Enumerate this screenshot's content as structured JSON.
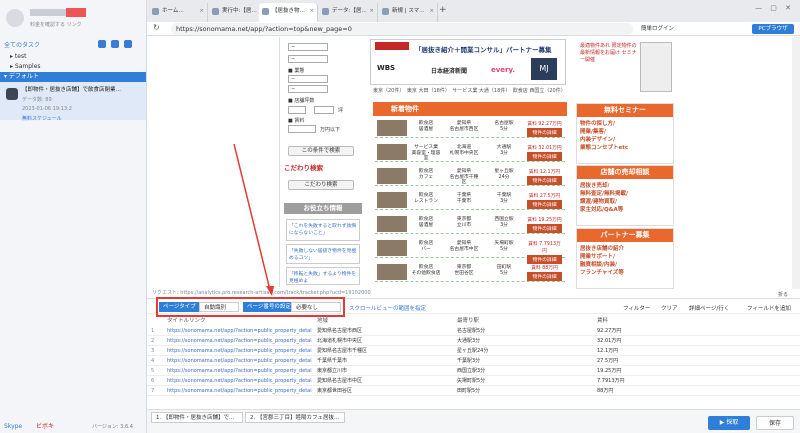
{
  "sidebar": {
    "account_sub": "料金を確認する リンク",
    "header": "全てのタスク",
    "tree": [
      {
        "label": "test"
      },
      {
        "label": "Samples"
      },
      {
        "label": "デフォルト"
      }
    ],
    "task": {
      "title": "【即物件・居抜き店舗】で飲食店閉業…",
      "created_label": "データ数: 89",
      "date": "2023-01-06 19:13:2",
      "status": "無料スケジュール"
    },
    "footer": {
      "skype": "Skype",
      "weibo": "ビボキ",
      "version": "バージョン: 3.6.4"
    }
  },
  "tabs": [
    {
      "label": "ホーム…",
      "active": false
    },
    {
      "label": "実行中:【居…",
      "active": false
    },
    {
      "label": "【居抜き物…",
      "active": true
    },
    {
      "label": "データ:【居…",
      "active": false
    },
    {
      "label": "新規 | スマ…",
      "active": false
    }
  ],
  "urlbar": {
    "url": "https://sonomama.net/app/?action=top&new_page=0",
    "login": "簡単ログイン",
    "browser_btn": "PCブラウザ"
  },
  "web": {
    "filters": {
      "label_kind": "業態",
      "label_area": "店舗坪数",
      "tsubo_unit": "坪",
      "label_rent": "賃料",
      "rent_unit": "万円以下",
      "select_default": "−",
      "search_btn": "この条件で検索",
      "kodawari_title": "こだわり検索",
      "kodawari_btn": "こだわり検索",
      "info_title": "お役立ち情報",
      "info_links": [
        "「これを失敗すると取れず後悔にならないこと」",
        "「失敗しない居抜き物件を見極めるコツ」",
        "「移転と失敗」するより物件を見極めよ"
      ]
    },
    "banner_top": "「居抜き紹介＋開業コンサル」パートナー募集",
    "logos": [
      "WBS",
      "日本経済新聞",
      "every.",
      "MJ"
    ],
    "stats": "東京（20件）　東京 大田（18件）　サービス業 大通（18件）　飲食店 西国立（20件）",
    "new_title": "新着物件",
    "listings": [
      {
        "type": "飲食店\n居酒屋",
        "area": "愛知県\n名古屋市西区",
        "station": "名古屋駅\n5分",
        "rent": "賃料 92.27万円",
        "go": "物件の詳細"
      },
      {
        "type": "サービス業\n美容室・理容室",
        "area": "北海道\n札幌市中央区",
        "station": "大通駅\n3分",
        "rent": "賃料 32.01万円",
        "go": "物件の詳細"
      },
      {
        "type": "飲食店\nカフェ",
        "area": "愛知県\n名古屋市千種区",
        "station": "星ヶ丘駅\n24分",
        "rent": "賃料 12.1万円",
        "go": "物件の詳細"
      },
      {
        "type": "飲食店\nレストラン",
        "area": "千葉県\n千葉市",
        "station": "千葉駅\n3分",
        "rent": "賃料 27.5万円",
        "go": "物件の詳細"
      },
      {
        "type": "飲食店\n居酒屋",
        "area": "東京都\n立川市",
        "station": "西国立駅\n3分",
        "rent": "賃料 19.25万円",
        "go": "物件の詳細"
      },
      {
        "type": "飲食店\nバー",
        "area": "愛知県\n名古屋市中区",
        "station": "矢場町駅\n5分",
        "rent": "賃料 7.7913万円",
        "go": "物件の詳細"
      },
      {
        "type": "飲食店\nその他飲食店",
        "area": "東京都\n世田谷区",
        "station": "田町駅\n5分",
        "rent": "賃料 88万円",
        "go": "物件の詳細"
      }
    ],
    "side_cards": [
      {
        "title": "無料セミナー",
        "body": "物件の探し方/\n開業/集客/\n内装デザイン/\n業態コンセプトetc"
      },
      {
        "title": "店舗の売却相談",
        "body": "居抜き売却/\n無料査定/無料掲載/\n譲渡/建物買取/\n家主対応/Q&A等"
      },
      {
        "title": "パートナー募集",
        "body": "居抜き店舗の紹介\n開業サポート/\n融資相談/内装/\nフランチャイズ等"
      }
    ],
    "promo_top_right": "最適物件あれ 限定物件の\n最新情報をお届け セミナー開催"
  },
  "capture": {
    "chip1": "ページタイプ",
    "chip1_val": "自動識別",
    "chip2": "ページ番号の設定",
    "chip2_val": "必要なし",
    "scroll_link": "スクロールビューの範囲を指定",
    "filter": "フィルター",
    "clear": "クリア",
    "detail": "詳細ページ/行く",
    "add_field": "フィールドを追加",
    "fold": "折る"
  },
  "status_url": "リクエスト: https://analytics.pro.research-artisan.com/track/tracker.php?ucd=19102000",
  "table": {
    "headers": [
      "タイトルリンク",
      "地域",
      "最寄り駅",
      "賃料"
    ],
    "rows": [
      {
        "n": "1",
        "link": "https://sonomama.net/app/?action=public_property_detail&pid=57",
        "area": "愛知県名古屋市西区",
        "st": "名古屋駅5分",
        "rent": "92.27万円"
      },
      {
        "n": "2",
        "link": "https://sonomama.net/app/?action=public_property_detail&pid=57",
        "area": "北海道札幌市中央区",
        "st": "大通駅3分",
        "rent": "32.01万円"
      },
      {
        "n": "3",
        "link": "https://sonomama.net/app/?action=public_property_detail&pid=57",
        "area": "愛知県名古屋市千種区",
        "st": "星ヶ丘駅24分",
        "rent": "12.1万円"
      },
      {
        "n": "4",
        "link": "https://sonomama.net/app/?action=public_property_detail&pid=57",
        "area": "千葉県千葉市",
        "st": "千葉駅3分",
        "rent": "27.5万円"
      },
      {
        "n": "5",
        "link": "https://sonomama.net/app/?action=public_property_detail&pid=57",
        "area": "東京都立川市",
        "st": "西国立駅3分",
        "rent": "19.25万円"
      },
      {
        "n": "6",
        "link": "https://sonomama.net/app/?action=public_property_detail&pid=57",
        "area": "愛知県名古屋市中区",
        "st": "矢場町駅5分",
        "rent": "7.7913万円"
      },
      {
        "n": "7",
        "link": "https://sonomama.net/app/?action=public_property_detail&pid=56",
        "area": "東京都世田谷区",
        "st": "田町駅5分",
        "rent": "88万円"
      }
    ]
  },
  "bottom": {
    "tab1": "1. 【即物件・居抜き店舗】で…",
    "tab2": "2. 【宮郡三丁目】睦陽カフェ居抜…",
    "run": "▶ 採取",
    "save": "保存"
  },
  "colors": {
    "accent": "#2f7fd9",
    "alert": "#e53935",
    "brand_orange": "#c64f2a"
  }
}
